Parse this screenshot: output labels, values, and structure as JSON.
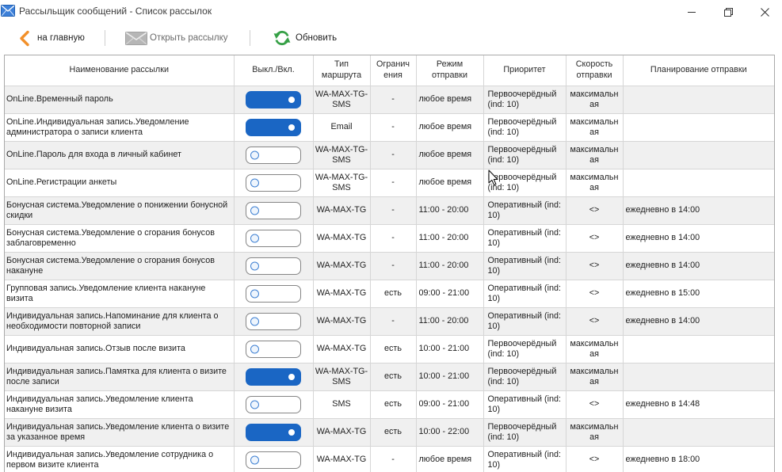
{
  "window": {
    "title": "Рассыльщик сообщений - Список рассылок",
    "app_icon": "envelope-icon",
    "controls": [
      "minimize-icon",
      "restore-icon",
      "close-icon"
    ]
  },
  "toolbar": {
    "back": {
      "label": "на главную",
      "icon": "chevron-left-icon"
    },
    "open": {
      "label": "Открыть рассылку",
      "icon": "envelope-icon",
      "disabled": true
    },
    "refresh": {
      "label": "Обновить",
      "icon": "refresh-icon"
    }
  },
  "table": {
    "columns": {
      "name": "Наименование рассылки",
      "enabled": "Выкл./Вкл.",
      "route": "Тип маршрута",
      "restriction": "Ограничения",
      "mode": "Режим отправки",
      "priority": "Приоритет",
      "speed": "Скорость отправки",
      "schedule": "Планирование отправки"
    },
    "rows": [
      {
        "name": "OnLine.Временный пароль",
        "enabled": true,
        "route": "WA-MAX-TG-SMS",
        "restriction": "-",
        "mode": "любое время",
        "priority": "Первоочерёдный (ind: 10)",
        "speed": "максимальная",
        "schedule": ""
      },
      {
        "name": "OnLine.Индивидуальная запись.Уведомление администратора о записи клиента",
        "enabled": true,
        "route": "Email",
        "restriction": "-",
        "mode": "любое время",
        "priority": "Первоочерёдный (ind: 10)",
        "speed": "максимальная",
        "schedule": ""
      },
      {
        "name": "OnLine.Пароль для входа в личный кабинет",
        "enabled": false,
        "route": "WA-MAX-TG-SMS",
        "restriction": "-",
        "mode": "любое время",
        "priority": "Первоочерёдный (ind: 10)",
        "speed": "максимальная",
        "schedule": ""
      },
      {
        "name": "OnLine.Регистрации анкеты",
        "enabled": false,
        "route": "WA-MAX-TG-SMS",
        "restriction": "-",
        "mode": "любое время",
        "priority": "Первоочерёдный (ind: 10)",
        "speed": "максимальная",
        "schedule": ""
      },
      {
        "name": "Бонусная система.Уведомление о понижении бонусной скидки",
        "enabled": false,
        "route": "WA-MAX-TG",
        "restriction": "-",
        "mode": "11:00 - 20:00",
        "priority": "Оперативный (ind: 10)",
        "speed": "<>",
        "schedule": "ежедневно в 14:00"
      },
      {
        "name": "Бонусная система.Уведомление о сгорания бонусов заблаговременно",
        "enabled": false,
        "route": "WA-MAX-TG",
        "restriction": "-",
        "mode": "11:00 - 20:00",
        "priority": "Оперативный (ind: 10)",
        "speed": "<>",
        "schedule": "ежедневно в 14:00"
      },
      {
        "name": "Бонусная система.Уведомление о сгорания бонусов накануне",
        "enabled": false,
        "route": "WA-MAX-TG",
        "restriction": "-",
        "mode": "11:00 - 20:00",
        "priority": "Оперативный (ind: 10)",
        "speed": "<>",
        "schedule": "ежедневно в 14:00"
      },
      {
        "name": "Групповая запись.Уведомление клиента накануне визита",
        "enabled": false,
        "route": "WA-MAX-TG",
        "restriction": "есть",
        "mode": "09:00 - 21:00",
        "priority": "Оперативный (ind: 10)",
        "speed": "<>",
        "schedule": "ежедневно в 15:00"
      },
      {
        "name": "Индивидуальная запись.Напоминание для клиента о необходимости повторной записи",
        "enabled": false,
        "route": "WA-MAX-TG",
        "restriction": "-",
        "mode": "11:00 - 20:00",
        "priority": "Оперативный (ind: 10)",
        "speed": "<>",
        "schedule": "ежедневно в 14:00"
      },
      {
        "name": "Индивидуальная запись.Отзыв после визита",
        "enabled": false,
        "route": "WA-MAX-TG",
        "restriction": "есть",
        "mode": "10:00 - 21:00",
        "priority": "Первоочерёдный (ind: 10)",
        "speed": "максимальная",
        "schedule": ""
      },
      {
        "name": "Индивидуальная запись.Памятка для клиента о визите после записи",
        "enabled": true,
        "route": "WA-MAX-TG-SMS",
        "restriction": "есть",
        "mode": "10:00 - 21:00",
        "priority": "Первоочерёдный (ind: 10)",
        "speed": "максимальная",
        "schedule": ""
      },
      {
        "name": "Индивидуальная запись.Уведомление клиента накануне визита",
        "enabled": false,
        "route": "SMS",
        "restriction": "есть",
        "mode": "09:00 - 21:00",
        "priority": "Оперативный (ind: 10)",
        "speed": "<>",
        "schedule": "ежедневно в 14:48"
      },
      {
        "name": "Индивидуальная запись.Уведомление клиента о визите за указанное время",
        "enabled": true,
        "route": "WA-MAX-TG",
        "restriction": "есть",
        "mode": "10:00 - 22:00",
        "priority": "Первоочерёдный (ind: 10)",
        "speed": "максимальная",
        "schedule": ""
      },
      {
        "name": "Индивидуальная запись.Уведомление сотрудника о первом визите клиента",
        "enabled": false,
        "route": "WA-MAX-TG",
        "restriction": "-",
        "mode": "любое время",
        "priority": "Оперативный (ind: 10)",
        "speed": "<>",
        "schedule": "ежедневно в 18:00"
      }
    ]
  },
  "colors": {
    "toggle_on": "#1a66c4",
    "back_accent": "#f2902a",
    "refresh_accent": "#36a046",
    "row_alt": "#f0f0f0",
    "grid_line": "#d6d6d6"
  }
}
